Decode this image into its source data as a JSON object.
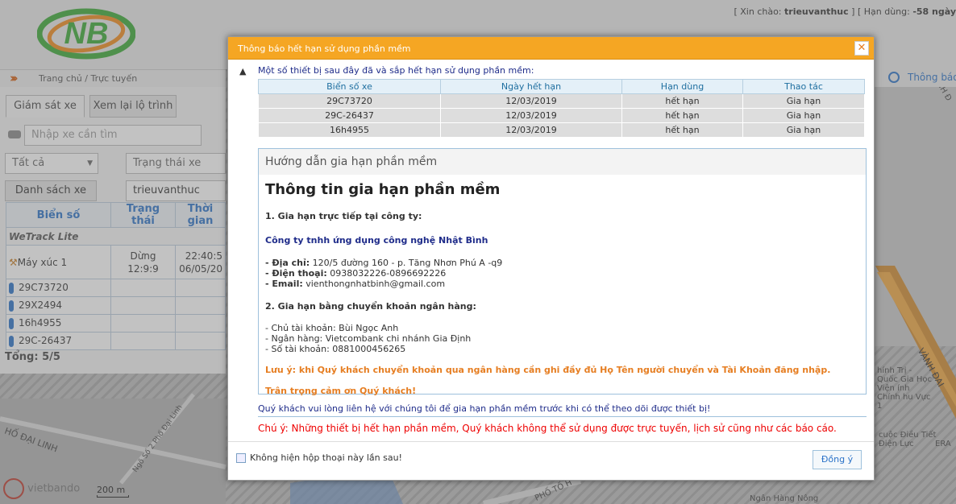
{
  "topbar": {
    "logo_text": "NB",
    "greeting_prefix": "[ Xin chào:",
    "username": "trieuvanthuc",
    "greeting_suffix": "]",
    "expiry_prefix": "[ Hạn dùng:",
    "expiry_value": "-58 ngày"
  },
  "breadcrumb": {
    "text": "Trang chủ / Trực tuyến"
  },
  "right_header": {
    "info_label": "Thông báo"
  },
  "sidebar": {
    "tabs": [
      "Giám sát xe",
      "Xem lại lộ trình"
    ],
    "search_placeholder": "Nhập xe cần tìm",
    "filter_value": "Tất cả",
    "status_placeholder": "Trạng thái xe",
    "list_button": "Danh sách xe",
    "account_value": "trieuvanthuc",
    "columns": [
      "Biển số",
      "Trạng thái",
      "Thời gian"
    ],
    "group": "WeTrack Lite",
    "first_vehicle": {
      "name": "Máy xúc 1",
      "status_line1": "Dừng",
      "status_line2": "12:9:9",
      "time_line1": "22:40:5",
      "time_line2": "06/05/20"
    },
    "vehicles": [
      "29C73720",
      "29X2494",
      "16h4955",
      "29C-26437"
    ],
    "total": "Tổng: 5/5"
  },
  "map": {
    "labels": [
      "HỐ ĐẠI LINH",
      "Ngõ Số 2 Phố Đại Linh",
      "PHỐ TỐ H",
      "Ngân Hàng Nông",
      "hính Trị - Quốc Gia Học Viện ính Chính hu Vực 1",
      "VÀNH ĐAI",
      "cuộc Điều Tiết Điện Lực",
      "ERA",
      "NH Đ"
    ],
    "brand": "vietbando",
    "scale": "200 m"
  },
  "dialog": {
    "title": "Thông báo hết hạn sử dụng phần mềm",
    "intro": "Một số thiết bị sau đây đã và sắp hết hạn sử dụng phần mềm:",
    "table_headers": [
      "Biển số xe",
      "Ngày hết hạn",
      "Hạn dùng",
      "Thao tác"
    ],
    "rows": [
      [
        "29C73720",
        "12/03/2019",
        "hết hạn",
        "Gia hạn"
      ],
      [
        "29C-26437",
        "12/03/2019",
        "hết hạn",
        "Gia hạn"
      ],
      [
        "16h4955",
        "12/03/2019",
        "hết hạn",
        "Gia hạn"
      ]
    ],
    "guide_header": "Hướng dẫn gia hạn phần mềm",
    "guide_title": "Thông tin gia hạn phần mềm",
    "section1": "1. Gia hạn trực tiếp tại công ty:",
    "company": "Công ty tnhh ứng dụng công nghệ Nhật Bình",
    "address_label": "- Địa chỉ:",
    "address": "120/5 đường 160 - p. Tăng Nhơn Phú A -q9",
    "phone_label": "- Điện thoại:",
    "phone": "0938032226-0896692226",
    "email_label": "- Email:",
    "email": "vienthongnhatbinh@gmail.com",
    "section2": "2. Gia hạn bằng chuyển khoản ngân hàng:",
    "account_holder": "- Chủ tài khoản: Bùi Ngọc Anh",
    "bank": "- Ngân hàng: Vietcombank chi nhánh Gia Định",
    "account_number": "- Số tài khoản: 0881000456265",
    "note": "Lưu ý: khi Quý khách chuyển khoản qua ngân hàng cần ghi đầy đủ Họ Tên người chuyển và Tài Khoản đăng nhập.",
    "thanks": "Trân trọng cảm ơn Quý khách!",
    "contact": "Quý khách vui lòng liên hệ với chúng tôi để gia hạn phần mềm trước khi có thể theo dõi được thiết bị!",
    "caution": "Chú ý: Những thiết bị hết hạn phần mềm, Quý khách không thể sử dụng được trực tuyến, lịch sử cũng như các báo cáo.",
    "checkbox_label": "Không hiện hộp thoại này lần sau!",
    "ok_label": "Đồng ý"
  },
  "colors": {
    "accent": "#f5a623",
    "link": "#2a72c8",
    "danger": "#ee0000",
    "navy": "#1f2c8a",
    "logo_green": "#3aa935",
    "logo_orange": "#f28b1b"
  }
}
